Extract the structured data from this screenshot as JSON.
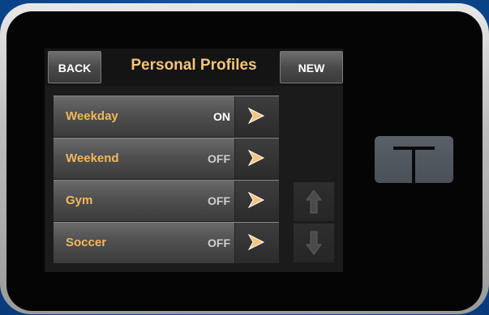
{
  "screen": {
    "header": {
      "back_label": "BACK",
      "title": "Personal Profiles",
      "new_label": "NEW"
    },
    "profiles": [
      {
        "name": "Weekday",
        "status": "ON"
      },
      {
        "name": "Weekend",
        "status": "OFF"
      },
      {
        "name": "Gym",
        "status": "OFF"
      },
      {
        "name": "Soccer",
        "status": "OFF"
      }
    ],
    "icons": {
      "row_arrow": "play-arrow-icon",
      "scroll_up": "arrow-up-icon",
      "scroll_down": "arrow-down-icon",
      "device_button": "t-logo-icon"
    }
  },
  "colors": {
    "title": "#f4c37c",
    "profile_name": "#f2b85c",
    "background": "#0e4f9c"
  }
}
